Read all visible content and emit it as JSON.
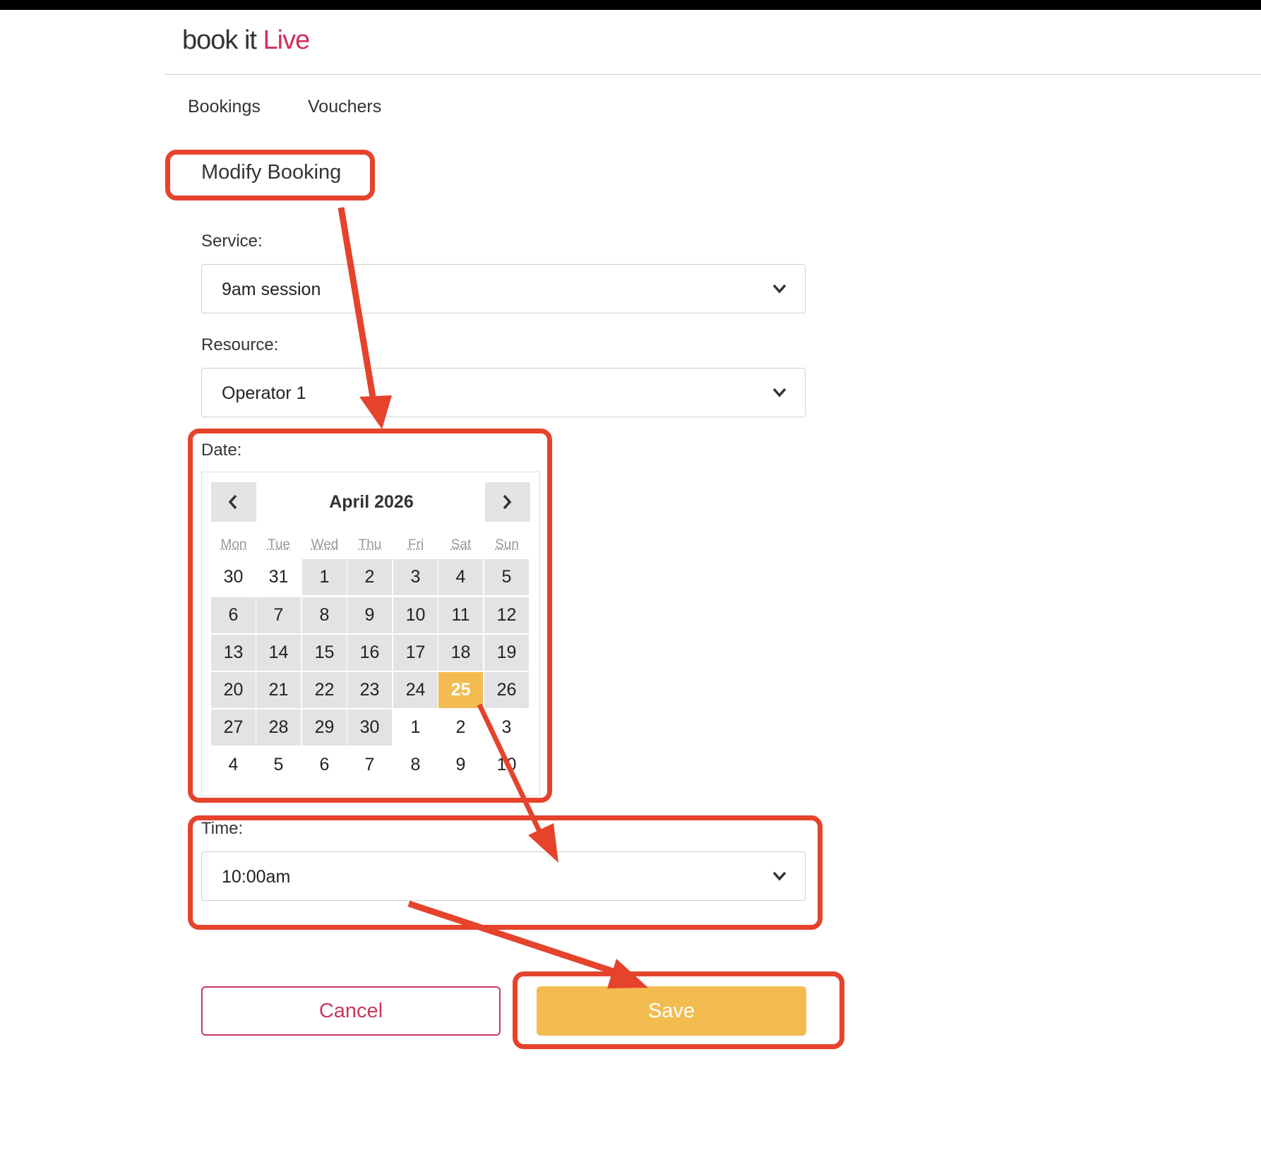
{
  "logo": {
    "part1": "book it ",
    "part2": "Live"
  },
  "nav": {
    "bookings": "Bookings",
    "vouchers": "Vouchers"
  },
  "page": {
    "title": "Modify Booking"
  },
  "service": {
    "label": "Service:",
    "value": "9am session"
  },
  "resource": {
    "label": "Resource:",
    "value": "Operator 1"
  },
  "date": {
    "label": "Date:",
    "month_title": "April 2026",
    "weekdays": [
      "Mon",
      "Tue",
      "Wed",
      "Thu",
      "Fri",
      "Sat",
      "Sun"
    ],
    "weeks": [
      [
        "30",
        "31",
        "1",
        "2",
        "3",
        "4",
        "5"
      ],
      [
        "6",
        "7",
        "8",
        "9",
        "10",
        "11",
        "12"
      ],
      [
        "13",
        "14",
        "15",
        "16",
        "17",
        "18",
        "19"
      ],
      [
        "20",
        "21",
        "22",
        "23",
        "24",
        "25",
        "26"
      ],
      [
        "27",
        "28",
        "29",
        "30",
        "1",
        "2",
        "3"
      ],
      [
        "4",
        "5",
        "6",
        "7",
        "8",
        "9",
        "10"
      ]
    ],
    "available_days": [
      "1",
      "2",
      "3",
      "4",
      "5",
      "6",
      "7",
      "8",
      "9",
      "10",
      "11",
      "12",
      "13",
      "14",
      "15",
      "16",
      "17",
      "18",
      "19",
      "20",
      "21",
      "22",
      "23",
      "24",
      "25",
      "26",
      "27",
      "28",
      "29",
      "30"
    ],
    "selected_day": "25"
  },
  "time": {
    "label": "Time:",
    "value": "10:00am"
  },
  "buttons": {
    "cancel": "Cancel",
    "save": "Save"
  },
  "colors": {
    "brand_pink": "#d12e5c",
    "accent_yellow": "#f2bc51",
    "available_day_bg": "#e2e3e5",
    "annotation_red": "#e5432b"
  }
}
